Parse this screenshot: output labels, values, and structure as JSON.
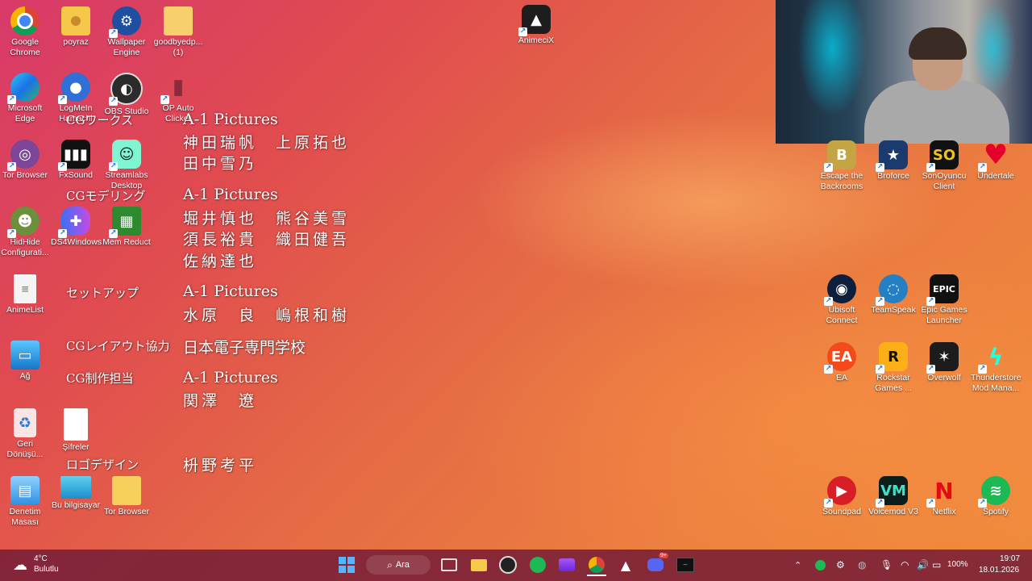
{
  "desktop_left": {
    "chrome": "Google Chrome",
    "poyraz": "poyraz",
    "wallpaper_engine": "Wallpaper Engine",
    "goodbyedp": "goodbyedp... (1)",
    "edge": "Microsoft Edge",
    "logmein": "LogMeIn Hamachi",
    "obs": "OBS Studio",
    "op_auto": "OP Auto Clicker",
    "tor": "Tor Browser",
    "fxsound": "FxSound",
    "streamlabs": "Streamlabs Desktop",
    "hidhide": "HidHide Configurati...",
    "ds4": "DS4Windows",
    "memreduct": "Mem Reduct",
    "animelist": "AnimeList",
    "ag": "Ağ",
    "recycle": "Geri Dönüşü...",
    "sifreler": "Şifreler",
    "denetim": "Denetim Masası",
    "bu_bilgisayar": "Bu bilgisayar",
    "tor_folder": "Tor Browser",
    "animecix": "AnimeciX"
  },
  "desktop_right": {
    "escape": "Escape the Backrooms",
    "brofORce": "Broforce",
    "sonoyuncu": "SonOyuncu Client",
    "undertale": "Undertale",
    "ubisoft": "Ubisoft Connect",
    "teamspeak": "TeamSpeak",
    "epic": "Epic Games Launcher",
    "ea": "EA",
    "rockstar": "Rockstar Games ...",
    "overwolf": "Overwolf",
    "thunderstore": "Thunderstore Mod Mana...",
    "soundpad": "Soundpad",
    "voicemod": "Voicemod V3",
    "netflix": "Netflix",
    "spotify": "Spotify"
  },
  "credits": {
    "role1": "CGワークス",
    "studio1": "A-1 Pictures",
    "names1a": "神田瑞帆　上原拓也",
    "names1b": "田中雪乃",
    "role2": "CGモデリング",
    "studio2": "A-1 Pictures",
    "names2a": "堀井慎也　熊谷美雪",
    "names2b": "須長裕貴　織田健吾",
    "names2c": "佐納達也",
    "role3": "セットアップ",
    "studio3": "A-1 Pictures",
    "names3a": "水原　良　嶋根和樹",
    "role4": "CGレイアウト協力",
    "studio4": "日本電子専門学校",
    "role5": "CG制作担当",
    "studio5": "A-1 Pictures",
    "names5a": "関澤　遼",
    "role6": "ロゴデザイン",
    "names6a": "枡野考平"
  },
  "taskbar": {
    "weather_temp": "4°C",
    "weather_desc": "Bulutlu",
    "search_label": "Ara",
    "battery": "100%",
    "time": "19:07",
    "date": "18.01.2026",
    "discord_badge": "9+"
  },
  "colors": {
    "taskbar_bg": "#7a1e37",
    "chrome": "#4285f4",
    "spotify": "#1db954",
    "netflix": "#e50914"
  }
}
